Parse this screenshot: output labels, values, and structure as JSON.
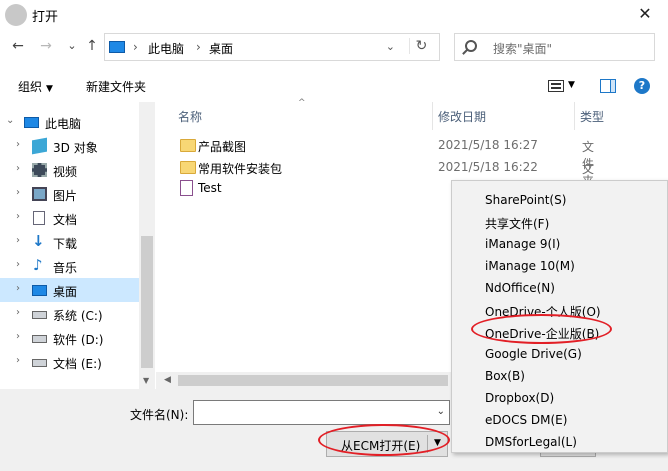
{
  "window": {
    "title": "打开",
    "close_glyph": "✕"
  },
  "nav": {
    "back": "←",
    "forward": "→",
    "history": "⌄",
    "up": "↑",
    "address": {
      "crumbs": [
        "此电脑",
        "桌面"
      ],
      "separator": "›",
      "dropdown": "⌄",
      "refresh": "↻"
    },
    "search": {
      "placeholder": "搜索\"桌面\""
    }
  },
  "toolbar": {
    "organize": "组织",
    "new_folder": "新建文件夹",
    "caret": "▼"
  },
  "sidebar": {
    "items": [
      {
        "label": "此电脑",
        "icon": "pc-icon",
        "expanded": true
      },
      {
        "label": "3D 对象",
        "icon": "cube-icon"
      },
      {
        "label": "视频",
        "icon": "video-icon"
      },
      {
        "label": "图片",
        "icon": "picture-icon"
      },
      {
        "label": "文档",
        "icon": "document-icon"
      },
      {
        "label": "下载",
        "icon": "download-icon"
      },
      {
        "label": "音乐",
        "icon": "music-icon"
      },
      {
        "label": "桌面",
        "icon": "desktop-icon",
        "selected": true
      },
      {
        "label": "系统 (C:)",
        "icon": "drive-icon"
      },
      {
        "label": "软件 (D:)",
        "icon": "drive-icon"
      },
      {
        "label": "文档 (E:)",
        "icon": "drive-icon"
      }
    ]
  },
  "files": {
    "columns": {
      "name": "名称",
      "date": "修改日期",
      "type": "类型",
      "sort_glyph": "^"
    },
    "rows": [
      {
        "name": "产品截图",
        "date": "2021/5/18 16:27",
        "type": "文件夹",
        "icon": "folder-icon"
      },
      {
        "name": "常用软件安装包",
        "date": "2021/5/18 16:22",
        "type": "文件夹",
        "icon": "folder-icon"
      },
      {
        "name": "Test",
        "date": "",
        "type": "",
        "icon": "file-icon"
      }
    ]
  },
  "bottom": {
    "filename_label": "文件名(N):",
    "filename_value": "",
    "open_ecm": "从ECM打开(E)",
    "open_ecm_arrow": "▼"
  },
  "menu": {
    "items": [
      "SharePoint(S)",
      "共享文件(F)",
      "iManage 9(I)",
      "iManage 10(M)",
      "NdOffice(N)",
      "OneDrive-个人版(O)",
      "OneDrive-企业版(B)",
      "Google Drive(G)",
      "Box(B)",
      "Dropbox(D)",
      "eDOCS DM(E)",
      "DMSforLegal(L)"
    ],
    "highlighted_index": 6
  },
  "colors": {
    "selection": "#cce8ff",
    "annotation": "#e21f26",
    "accent": "#1e78c8"
  }
}
